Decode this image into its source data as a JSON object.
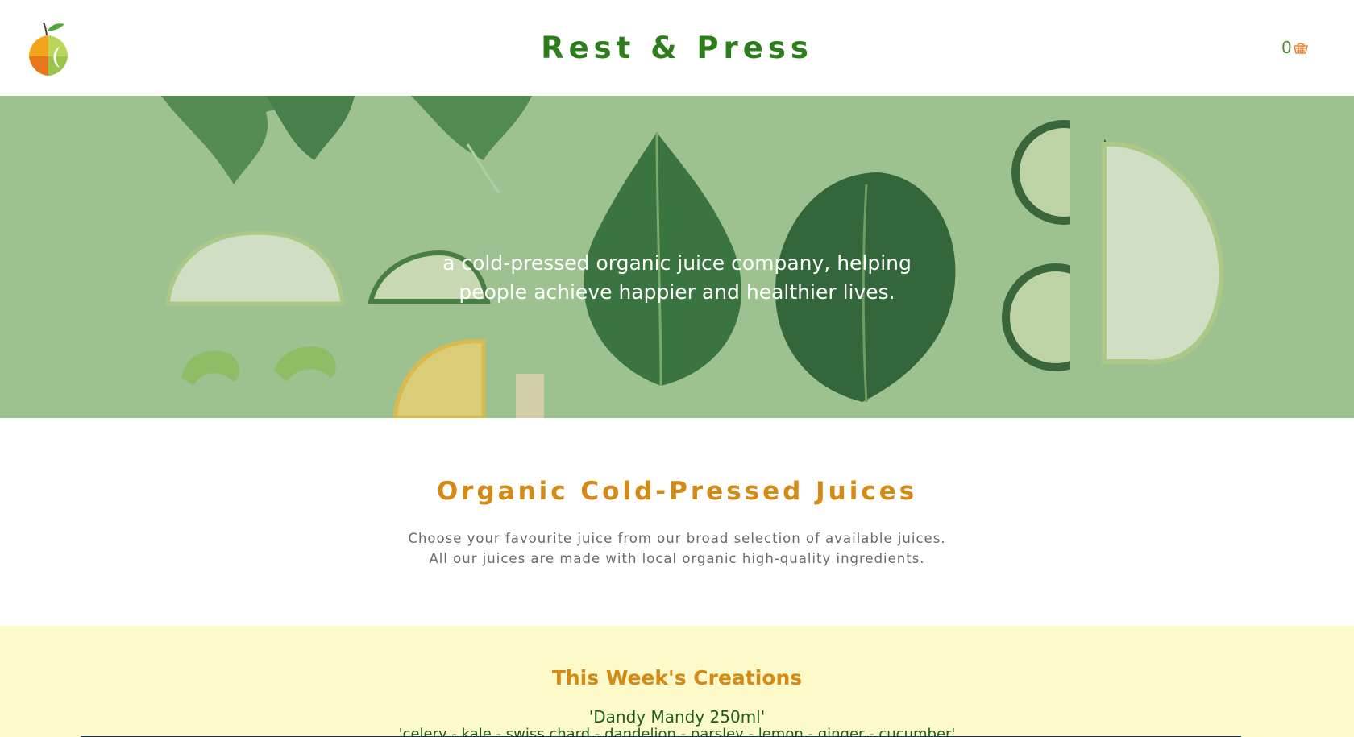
{
  "header": {
    "title": "Rest & Press",
    "cart_count": "0",
    "cart_icon": "basket-icon",
    "logo_icon": "fruit-logo-icon"
  },
  "hero": {
    "tagline_line1": "a cold-pressed organic juice company, helping",
    "tagline_line2": "people achieve happier and healthier lives."
  },
  "intro": {
    "heading": "Organic Cold-Pressed Juices",
    "line1": "Choose your favourite juice from our broad selection of available juices.",
    "line2": "All our juices are made with local organic high-quality ingredients."
  },
  "weekly": {
    "heading": "This Week's Creations",
    "juice_name": "'Dandy Mandy 250ml'",
    "juice_ingredients": "'celery - kale - swiss chard - dandelion - parsley - lemon - ginger - cucumber'"
  },
  "colors": {
    "brand_green": "#2e7d1c",
    "accent_orange": "#d58a15",
    "hero_bg": "#a9cf9b",
    "weekly_bg": "#fbfac8"
  }
}
